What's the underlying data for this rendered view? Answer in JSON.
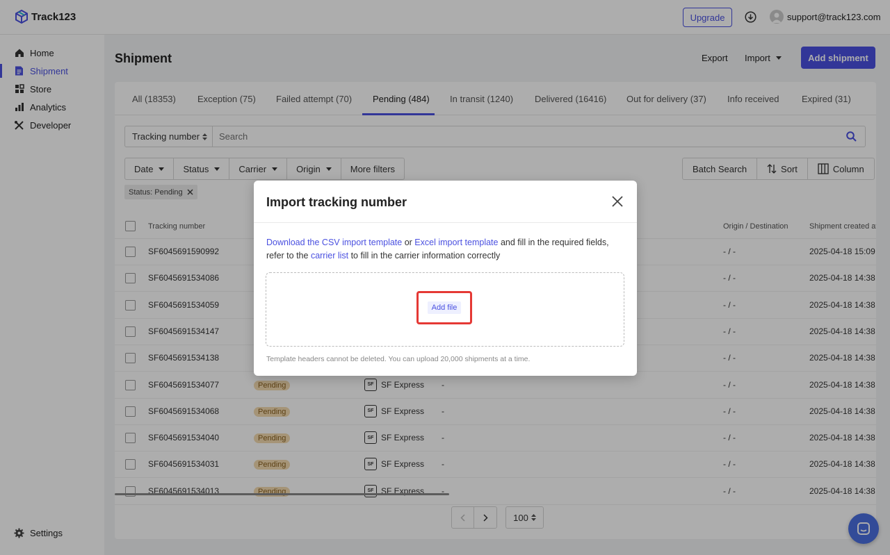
{
  "app": {
    "name": "Track123"
  },
  "header": {
    "upgrade_label": "Upgrade",
    "user_email": "support@track123.com"
  },
  "sidebar": {
    "items": [
      {
        "label": "Home",
        "icon": "home-icon"
      },
      {
        "label": "Shipment",
        "icon": "document-icon",
        "active": true
      },
      {
        "label": "Store",
        "icon": "grid-icon"
      },
      {
        "label": "Analytics",
        "icon": "bar-chart-icon"
      },
      {
        "label": "Developer",
        "icon": "tools-icon"
      }
    ],
    "settings_label": "Settings"
  },
  "page": {
    "title": "Shipment",
    "export_label": "Export",
    "import_label": "Import",
    "add_shipment_label": "Add shipment"
  },
  "tabs": [
    {
      "label": "All (18353)"
    },
    {
      "label": "Exception (75)"
    },
    {
      "label": "Failed attempt (70)"
    },
    {
      "label": "Pending (484)",
      "active": true
    },
    {
      "label": "In transit (1240)"
    },
    {
      "label": "Delivered (16416)"
    },
    {
      "label": "Out for delivery (37)"
    },
    {
      "label": "Info received"
    },
    {
      "label": "Expired (31)"
    }
  ],
  "search": {
    "type_label": "Tracking number",
    "placeholder": "Search"
  },
  "filters": [
    "Date",
    "Status",
    "Carrier",
    "Origin",
    "More filters"
  ],
  "actions": {
    "batch_search": "Batch Search",
    "sort": "Sort",
    "column": "Column"
  },
  "active_filter_chip": "Status: Pending",
  "table": {
    "columns": {
      "tracking": "Tracking number",
      "origin_dest": "Origin / Destination",
      "created": "Shipment created at"
    },
    "rows": [
      {
        "tracking": "SF6045691590992",
        "status": "",
        "carrier": "",
        "dash": "",
        "route": "- / -",
        "created": "2025-04-18 15:09"
      },
      {
        "tracking": "SF6045691534086",
        "status": "",
        "carrier": "",
        "dash": "",
        "route": "- / -",
        "created": "2025-04-18 14:38"
      },
      {
        "tracking": "SF6045691534059",
        "status": "",
        "carrier": "",
        "dash": "",
        "route": "- / -",
        "created": "2025-04-18 14:38"
      },
      {
        "tracking": "SF6045691534147",
        "status": "",
        "carrier": "",
        "dash": "",
        "route": "- / -",
        "created": "2025-04-18 14:38"
      },
      {
        "tracking": "SF6045691534138",
        "status": "",
        "carrier": "",
        "dash": "",
        "route": "- / -",
        "created": "2025-04-18 14:38"
      },
      {
        "tracking": "SF6045691534077",
        "status": "Pending",
        "carrier": "SF Express",
        "dash": "-",
        "route": "- / -",
        "created": "2025-04-18 14:38"
      },
      {
        "tracking": "SF6045691534068",
        "status": "Pending",
        "carrier": "SF Express",
        "dash": "-",
        "route": "- / -",
        "created": "2025-04-18 14:38"
      },
      {
        "tracking": "SF6045691534040",
        "status": "Pending",
        "carrier": "SF Express",
        "dash": "-",
        "route": "- / -",
        "created": "2025-04-18 14:38"
      },
      {
        "tracking": "SF6045691534031",
        "status": "Pending",
        "carrier": "SF Express",
        "dash": "-",
        "route": "- / -",
        "created": "2025-04-18 14:38"
      },
      {
        "tracking": "SF6045691534013",
        "status": "Pending",
        "carrier": "SF Express",
        "dash": "-",
        "route": "- / -",
        "created": "2025-04-18 14:38"
      }
    ]
  },
  "pagination": {
    "page_size": "100"
  },
  "modal": {
    "title": "Import tracking number",
    "csv_link": "Download the CSV import template",
    "or_text": " or ",
    "excel_link": "Excel import template",
    "desc_mid": " and fill in the required fields, refer to the ",
    "carrier_link": "carrier list",
    "desc_end": " to fill in the carrier information correctly",
    "add_file_label": "Add file",
    "note": "Template headers cannot be deleted. You can upload 20,000 shipments at a time."
  },
  "colors": {
    "accent": "#4a50e0",
    "pending_badge": "#f3dbb0",
    "highlight": "#e53935"
  }
}
